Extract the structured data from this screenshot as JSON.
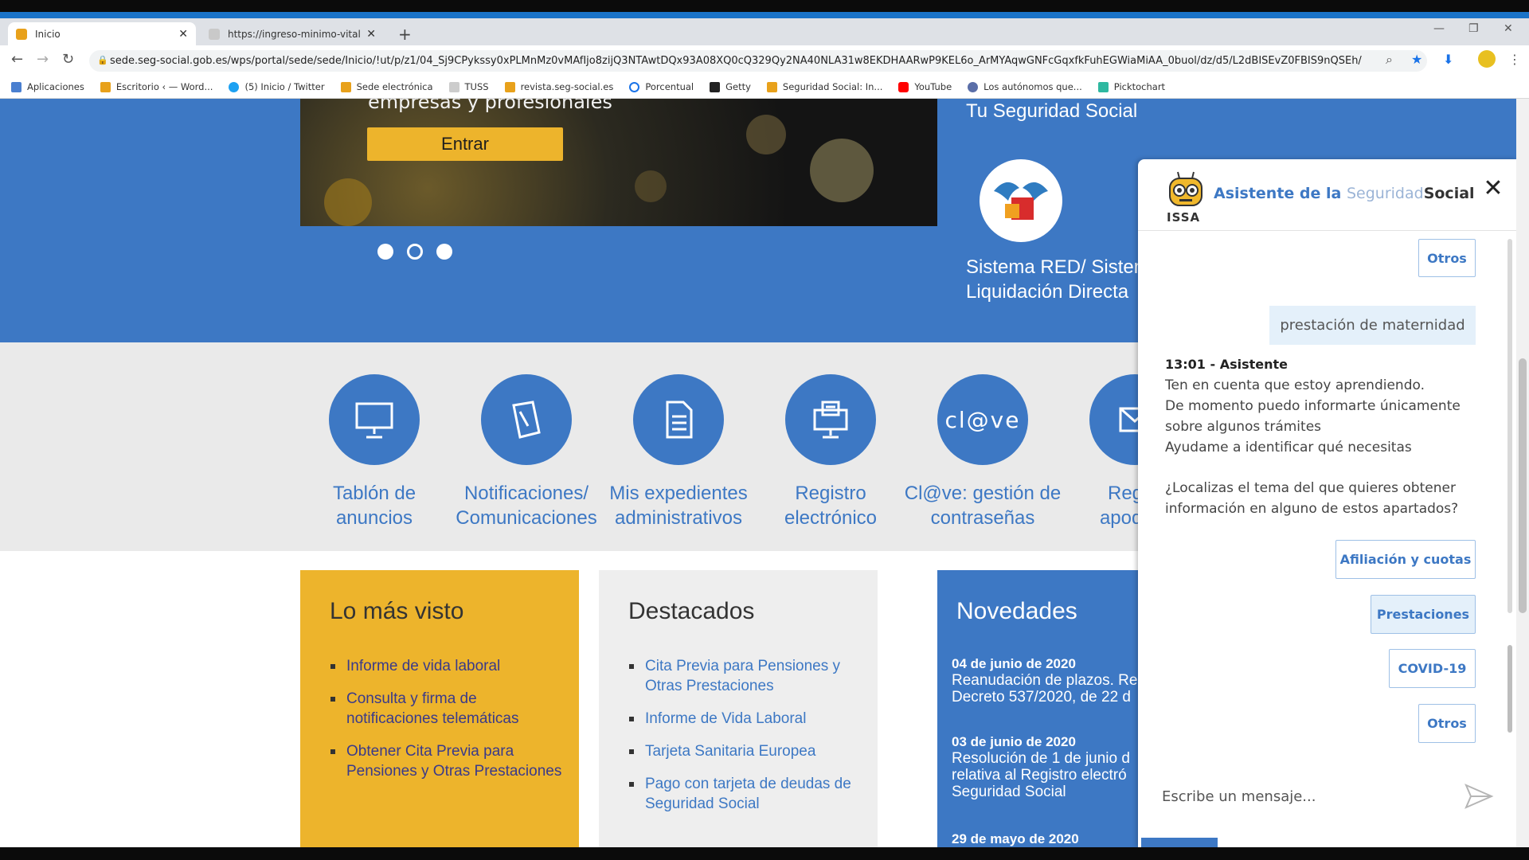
{
  "browser": {
    "tabs": [
      {
        "label": "Inicio",
        "active": true
      },
      {
        "label": "https://ingreso-minimo-vital.seg",
        "active": false
      }
    ],
    "url": "sede.seg-social.gob.es/wps/portal/sede/sede/Inicio/!ut/p/z1/04_Sj9CPykssy0xPLMnMz0vMAfIjo8zijQ3NTAwtDQx93A08XQ0cQ329Qy2NA40NLA31w8EKDHAARwP9KEL6o_ArMYAqwGNFcGqxfkFuhEGWiaMiAA_0buol/dz/d5/L2dBISEvZ0FBIS9nQSEh/",
    "bookmarks": [
      "Aplicaciones",
      "Escritorio ‹ — Word...",
      "(5) Inicio / Twitter",
      "Sede electrónica",
      "TUSS",
      "revista.seg-social.es",
      "Porcentual",
      "Getty",
      "Seguridad Social: In...",
      "YouTube",
      "Los autónomos que...",
      "Picktochart"
    ]
  },
  "hero": {
    "banner_subtitle": "empresas y profesionales",
    "enter_button": "Entrar",
    "tu_seguridad": "Tu Seguridad Social",
    "sistema_line1": "Sistema RED/ Sistem",
    "sistema_line2": "Liquidación Directa"
  },
  "services": [
    {
      "line1": "Tablón de",
      "line2": "anuncios",
      "icon": "presentation-board-icon"
    },
    {
      "line1": "Notificaciones/",
      "line2": "Comunicaciones",
      "icon": "notification-document-icon"
    },
    {
      "line1": "Mis expedientes",
      "line2": "administrativos",
      "icon": "file-document-icon"
    },
    {
      "line1": "Registro",
      "line2": "electrónico",
      "icon": "computer-register-icon"
    },
    {
      "line1": "Cl@ve: gestión de",
      "line2": "contraseñas",
      "icon": "clave-logo-icon",
      "icon_text": "cl@ve"
    },
    {
      "line1": "Regist",
      "line2": "apodera",
      "icon": "mail-icon"
    }
  ],
  "panels": {
    "visto": {
      "title": "Lo más visto",
      "items": [
        "Informe de vida laboral",
        "Consulta y firma de notificaciones telemáticas",
        "Obtener Cita Previa para Pensiones y Otras Prestaciones"
      ]
    },
    "destacados": {
      "title": "Destacados",
      "items": [
        "Cita Previa para Pensiones y Otras Prestaciones",
        "Informe de Vida Laboral",
        "Tarjeta Sanitaria Europea",
        "Pago con tarjeta de deudas de Seguridad Social"
      ]
    },
    "novedades": {
      "title": "Novedades",
      "items": [
        {
          "date": "04 de junio de 2020",
          "lines": [
            "Reanudación de plazos. Re",
            "Decreto 537/2020, de 22 d"
          ]
        },
        {
          "date": "03 de junio de 2020",
          "lines": [
            "Resolución de 1 de junio d",
            "relativa al Registro electró",
            "Seguridad Social"
          ]
        },
        {
          "date": "29 de mayo de 2020",
          "lines": []
        }
      ]
    }
  },
  "chat": {
    "title_part1": "Asistente de la ",
    "title_part2": "Seguridad",
    "title_part3": "Social",
    "logo_text": "ISSA",
    "close_symbol": "✕",
    "otros_top": "Otros",
    "user_message": "prestación de maternidad",
    "bot_time": "13:01 - Asistente",
    "bot_lines": [
      "Ten en cuenta que estoy aprendiendo.",
      "De momento puedo informarte únicamente",
      "sobre algunos trámites",
      "Ayudame a identificar qué necesitas",
      "¿Localizas el tema del que quieres obtener",
      "información en alguno de estos apartados?"
    ],
    "options": [
      "Afiliación y cuotas",
      "Prestaciones",
      "COVID-19",
      "Otros"
    ],
    "input_placeholder": "Escribe un mensaje..."
  },
  "colors": {
    "primary_blue": "#3d78c4",
    "accent_yellow": "#edb42c",
    "light_gray": "#eaeaea"
  }
}
